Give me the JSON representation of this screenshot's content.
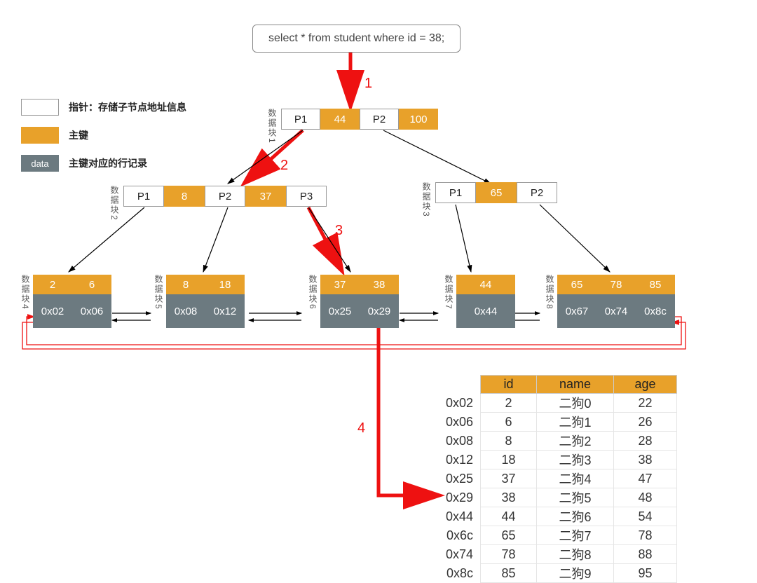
{
  "query": "select * from student where id = 38;",
  "legend": {
    "pointer": "指针：存储子节点地址信息",
    "key": "主键",
    "data_swatch_text": "data",
    "data": "主键对应的行记录"
  },
  "block_label_prefix": "数据块",
  "steps": {
    "s1": "1",
    "s2": "2",
    "s3": "3",
    "s4": "4"
  },
  "root": {
    "block_no": "1",
    "cells": [
      {
        "t": "ptr",
        "v": "P1"
      },
      {
        "t": "key",
        "v": "44"
      },
      {
        "t": "ptr",
        "v": "P2"
      },
      {
        "t": "key",
        "v": "100"
      }
    ]
  },
  "mid_left": {
    "block_no": "2",
    "cells": [
      {
        "t": "ptr",
        "v": "P1"
      },
      {
        "t": "key",
        "v": "8"
      },
      {
        "t": "ptr",
        "v": "P2"
      },
      {
        "t": "key",
        "v": "37"
      },
      {
        "t": "ptr",
        "v": "P3"
      }
    ]
  },
  "mid_right": {
    "block_no": "3",
    "cells": [
      {
        "t": "ptr",
        "v": "P1"
      },
      {
        "t": "key",
        "v": "65"
      },
      {
        "t": "ptr",
        "v": "P2"
      }
    ]
  },
  "leaves": [
    {
      "block_no": "4",
      "keys": [
        "2",
        "6"
      ],
      "data": [
        "0x02",
        "0x06"
      ]
    },
    {
      "block_no": "5",
      "keys": [
        "8",
        "18"
      ],
      "data": [
        "0x08",
        "0x12"
      ]
    },
    {
      "block_no": "6",
      "keys": [
        "37",
        "38"
      ],
      "data": [
        "0x25",
        "0x29"
      ]
    },
    {
      "block_no": "7",
      "keys": [
        "44"
      ],
      "data": [
        "0x44"
      ]
    },
    {
      "block_no": "8",
      "keys": [
        "65",
        "78",
        "85"
      ],
      "data": [
        "0x67",
        "0x74",
        "0x8c"
      ]
    }
  ],
  "table": {
    "headers": [
      "id",
      "name",
      "age"
    ],
    "rows": [
      {
        "addr": "0x02",
        "id": "2",
        "name": "二狗0",
        "age": "22"
      },
      {
        "addr": "0x06",
        "id": "6",
        "name": "二狗1",
        "age": "26"
      },
      {
        "addr": "0x08",
        "id": "8",
        "name": "二狗2",
        "age": "28"
      },
      {
        "addr": "0x12",
        "id": "18",
        "name": "二狗3",
        "age": "38"
      },
      {
        "addr": "0x25",
        "id": "37",
        "name": "二狗4",
        "age": "47"
      },
      {
        "addr": "0x29",
        "id": "38",
        "name": "二狗5",
        "age": "48"
      },
      {
        "addr": "0x44",
        "id": "44",
        "name": "二狗6",
        "age": "54"
      },
      {
        "addr": "0x6c",
        "id": "65",
        "name": "二狗7",
        "age": "78"
      },
      {
        "addr": "0x74",
        "id": "78",
        "name": "二狗8",
        "age": "88"
      },
      {
        "addr": "0x8c",
        "id": "85",
        "name": "二狗9",
        "age": "95"
      }
    ]
  },
  "chart_data": {
    "type": "table",
    "title": "B+Tree primary-key index lookup for id=38",
    "root_keys": [
      44,
      100
    ],
    "level2": [
      {
        "block": 2,
        "keys": [
          8,
          37
        ]
      },
      {
        "block": 3,
        "keys": [
          65
        ]
      }
    ],
    "leaf_blocks": [
      {
        "block": 4,
        "keys": [
          2,
          6
        ],
        "row_ptrs": [
          "0x02",
          "0x06"
        ]
      },
      {
        "block": 5,
        "keys": [
          8,
          18
        ],
        "row_ptrs": [
          "0x08",
          "0x12"
        ]
      },
      {
        "block": 6,
        "keys": [
          37,
          38
        ],
        "row_ptrs": [
          "0x25",
          "0x29"
        ]
      },
      {
        "block": 7,
        "keys": [
          44
        ],
        "row_ptrs": [
          "0x44"
        ]
      },
      {
        "block": 8,
        "keys": [
          65,
          78,
          85
        ],
        "row_ptrs": [
          "0x67",
          "0x74",
          "0x8c"
        ]
      }
    ],
    "rows": [
      {
        "addr": "0x02",
        "id": 2,
        "name": "二狗0",
        "age": 22
      },
      {
        "addr": "0x06",
        "id": 6,
        "name": "二狗1",
        "age": 26
      },
      {
        "addr": "0x08",
        "id": 8,
        "name": "二狗2",
        "age": 28
      },
      {
        "addr": "0x12",
        "id": 18,
        "name": "二狗3",
        "age": 38
      },
      {
        "addr": "0x25",
        "id": 37,
        "name": "二狗4",
        "age": 47
      },
      {
        "addr": "0x29",
        "id": 38,
        "name": "二狗5",
        "age": 48
      },
      {
        "addr": "0x44",
        "id": 44,
        "name": "二狗6",
        "age": 54
      },
      {
        "addr": "0x6c",
        "id": 65,
        "name": "二狗7",
        "age": 78
      },
      {
        "addr": "0x74",
        "id": 78,
        "name": "二狗8",
        "age": 88
      },
      {
        "addr": "0x8c",
        "id": 85,
        "name": "二狗9",
        "age": 95
      }
    ],
    "search_path_steps": [
      1,
      2,
      3,
      4
    ],
    "search_key": 38,
    "found_row_ptr": "0x29"
  }
}
